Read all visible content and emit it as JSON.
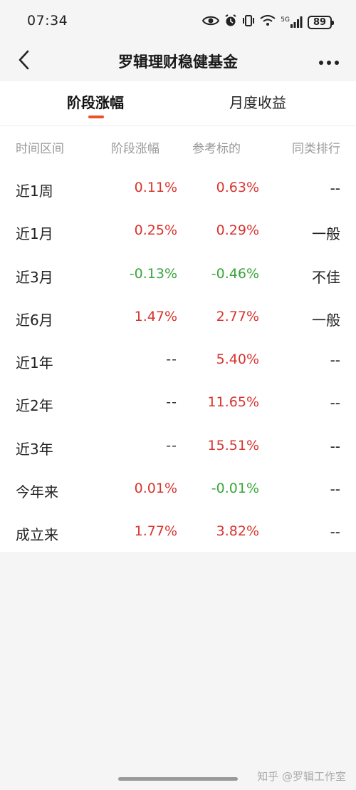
{
  "status_bar": {
    "time": "07:34",
    "signal_label": "5G",
    "battery": "89",
    "icons": [
      "eye-icon",
      "alarm-icon",
      "vibrate-icon",
      "wifi-icon",
      "signal-icon",
      "battery-icon"
    ]
  },
  "nav": {
    "title": "罗辑理财稳健基金",
    "back_icon": "chevron-left-icon",
    "more_icon": "more-horizontal-icon"
  },
  "tabs": [
    {
      "label": "阶段涨幅",
      "active": true
    },
    {
      "label": "月度收益",
      "active": false
    }
  ],
  "table": {
    "headers": [
      "时间区间",
      "阶段涨幅",
      "参考标的",
      "同类排行"
    ],
    "rows": [
      {
        "period": "近1周",
        "change": "0.11%",
        "benchmark": "0.63%",
        "rank": "--"
      },
      {
        "period": "近1月",
        "change": "0.25%",
        "benchmark": "0.29%",
        "rank": "一般"
      },
      {
        "period": "近3月",
        "change": "-0.13%",
        "benchmark": "-0.46%",
        "rank": "不佳"
      },
      {
        "period": "近6月",
        "change": "1.47%",
        "benchmark": "2.77%",
        "rank": "一般"
      },
      {
        "period": "近1年",
        "change": "--",
        "benchmark": "5.40%",
        "rank": "--"
      },
      {
        "period": "近2年",
        "change": "--",
        "benchmark": "11.65%",
        "rank": "--"
      },
      {
        "period": "近3年",
        "change": "--",
        "benchmark": "15.51%",
        "rank": "--"
      },
      {
        "period": "今年来",
        "change": "0.01%",
        "benchmark": "-0.01%",
        "rank": "--"
      },
      {
        "period": "成立来",
        "change": "1.77%",
        "benchmark": "3.82%",
        "rank": "--"
      }
    ]
  },
  "colors": {
    "positive": "#d7352f",
    "negative": "#3aa53a",
    "accent": "#e8532b"
  },
  "watermark": "知乎 @罗辑工作室"
}
